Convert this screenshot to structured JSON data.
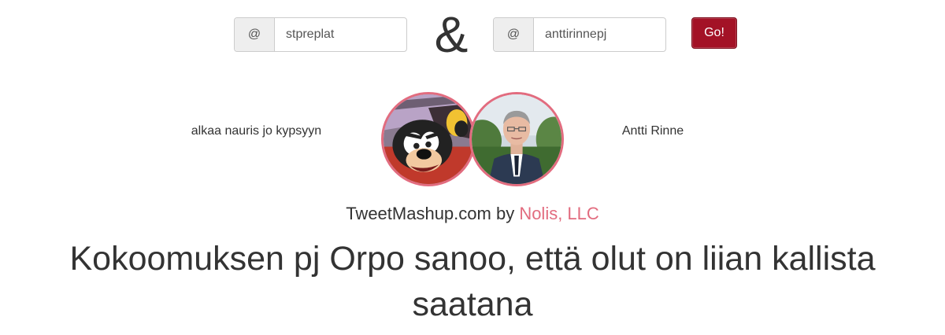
{
  "form": {
    "at_symbol": "@",
    "user1_value": "stpreplat",
    "user2_value": "anttirinnepj",
    "ampersand": "&",
    "go_label": "Go!"
  },
  "users": {
    "left_name": "alkaa nauris jo kypsyyn",
    "right_name": "Antti Rinne"
  },
  "footer": {
    "site": "TweetMashup.com by ",
    "company": "Nolis, LLC"
  },
  "tweet": {
    "text": "Kokoomuksen pj Orpo sanoo, että olut on liian kallista saatana"
  },
  "colors": {
    "accent_pink": "#e26c7f",
    "go_button": "#a31226",
    "text": "#333333"
  }
}
